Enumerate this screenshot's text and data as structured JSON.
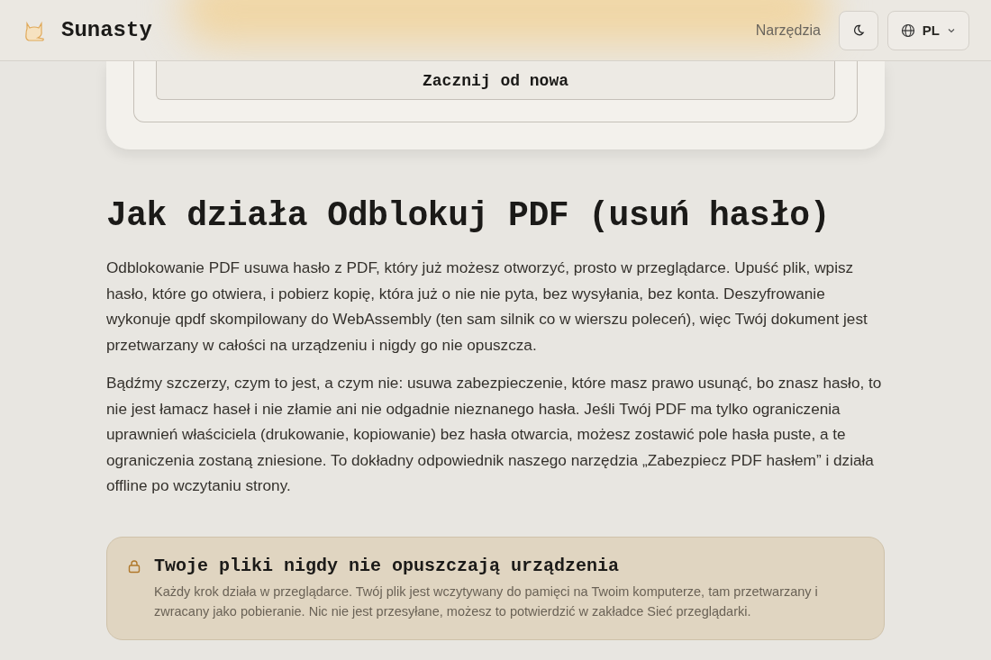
{
  "header": {
    "brand": "Sunasty",
    "nav_link": "Narzędzia",
    "language": "PL"
  },
  "tool_card": {
    "button": "Zacznij od nowa"
  },
  "article": {
    "title": "Jak działa Odblokuj PDF (usuń hasło)",
    "paragraphs": [
      "Odblokowanie PDF usuwa hasło z PDF, który już możesz otworzyć, prosto w przeglądarce. Upuść plik, wpisz hasło, które go otwiera, i pobierz kopię, która już o nie nie pyta, bez wysyłania, bez konta. Deszyfrowanie wykonuje qpdf skompilowany do WebAssembly (ten sam silnik co w wierszu poleceń), więc Twój dokument jest przetwarzany w całości na urządzeniu i nigdy go nie opuszcza.",
      "Bądźmy szczerzy, czym to jest, a czym nie: usuwa zabezpieczenie, które masz prawo usunąć, bo znasz hasło, to nie jest łamacz haseł i nie złamie ani nie odgadnie nieznanego hasła. Jeśli Twój PDF ma tylko ograniczenia uprawnień właściciela (drukowanie, kopiowanie) bez hasła otwarcia, możesz zostawić pole hasła puste, a te ograniczenia zostaną zniesione. To dokładny odpowiednik naszego narzędzia „Zabezpiecz PDF hasłem” i działa offline po wczytaniu strony."
    ]
  },
  "privacy_note": {
    "title": "Twoje pliki nigdy nie opuszczają urządzenia",
    "text": "Każdy krok działa w przeglądarce. Twój plik jest wczytywany do pamięci na Twoim komputerze, tam przetwarzany i zwracany jako pobieranie. Nic nie jest przesyłane, możesz to potwierdzić w zakładce Sieć przeglądarki."
  }
}
